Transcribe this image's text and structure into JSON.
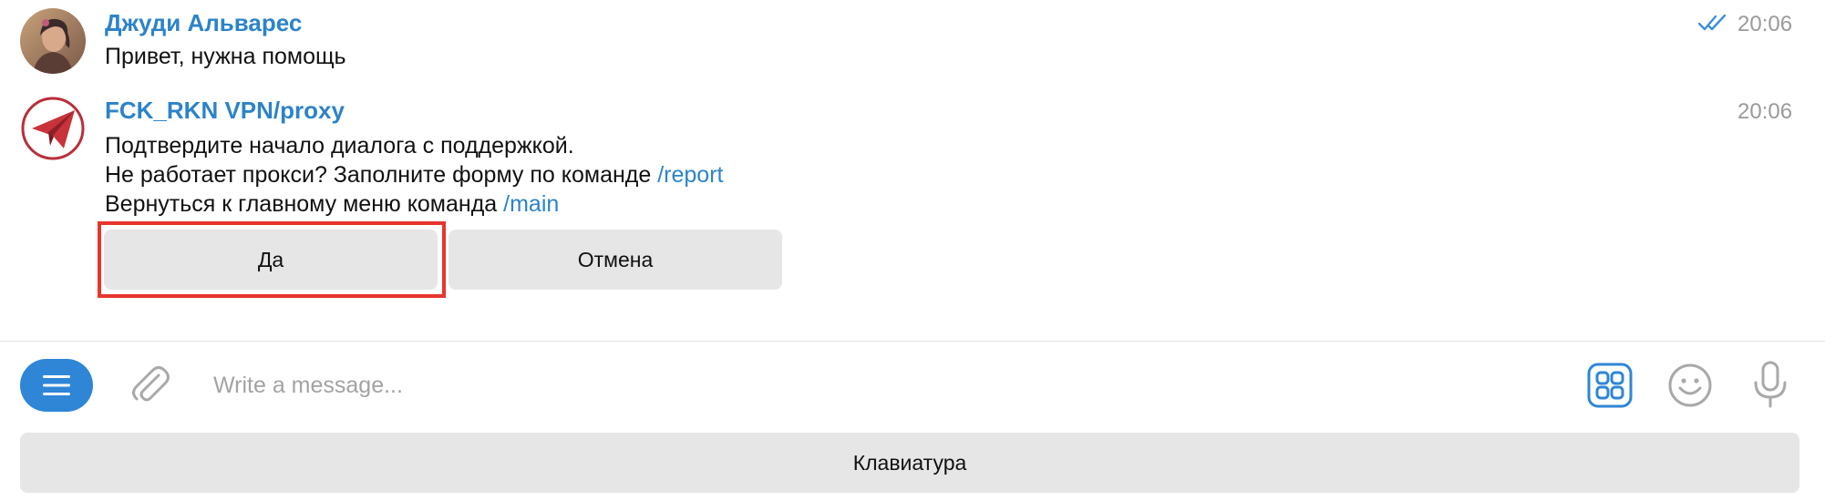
{
  "messages": [
    {
      "sender": "Джуди Альварес",
      "time": "20:06",
      "status_icon": "double-check-read-icon",
      "lines": [
        {
          "text": "Привет, нужна помощь"
        }
      ]
    },
    {
      "sender": "FCK_RKN VPN/proxy",
      "time": "20:06",
      "lines": [
        {
          "text": "Подтвердите начало диалога с поддержкой."
        },
        {
          "text": "Не работает прокси? Заполните форму по команде ",
          "command": "/report"
        },
        {
          "text": "Вернуться к главному меню команда ",
          "command": "/main"
        }
      ],
      "inline_buttons": [
        {
          "label": "Да",
          "highlighted": true
        },
        {
          "label": "Отмена"
        }
      ]
    }
  ],
  "composer": {
    "placeholder": "Write a message...",
    "value": "",
    "menu_icon": "menu-icon",
    "attach_icon": "paperclip-icon",
    "keyboard_toggle_icon": "bot-keyboard-icon",
    "emoji_icon": "emoji-icon",
    "mic_icon": "microphone-icon",
    "keyboard_button_label": "Клавиатура"
  },
  "colors": {
    "accent": "#2f86d6",
    "link": "#2d83c8",
    "button_bg": "#e6e6e6",
    "highlight": "#e8352c",
    "timestamp": "#9a9a9a"
  }
}
